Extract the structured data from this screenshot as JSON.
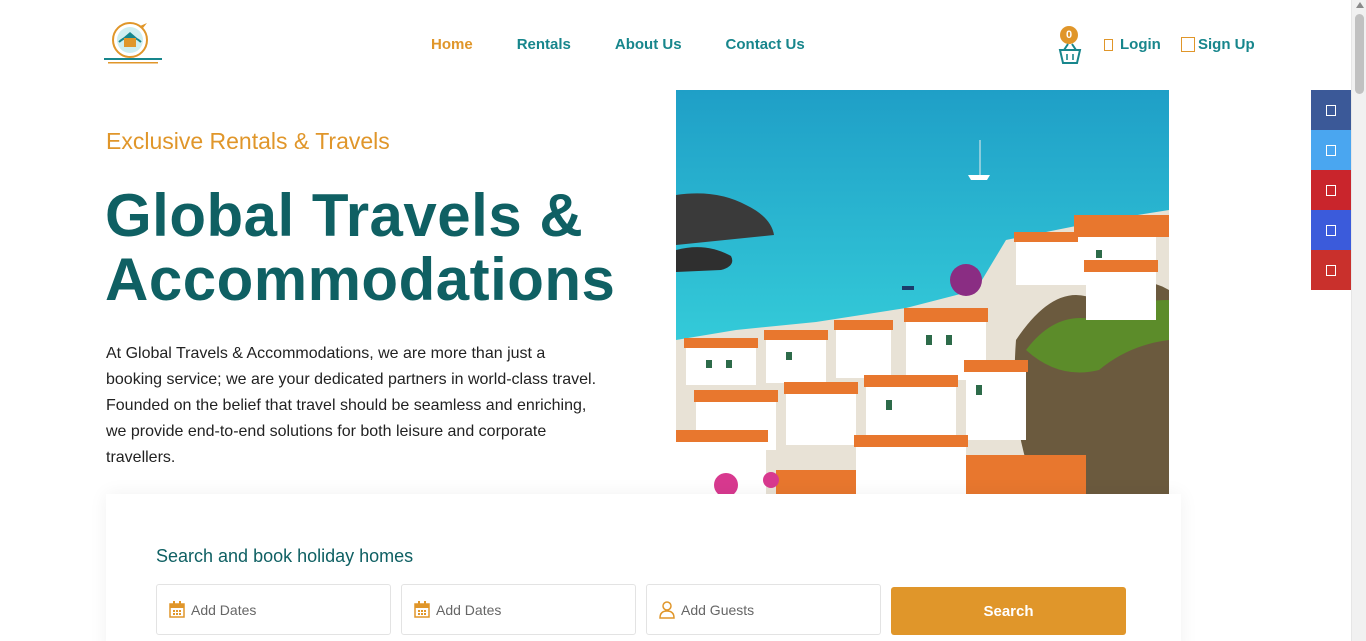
{
  "brand": {
    "logo_text": "Global Travels & Accommodations",
    "logo_tagline": "Exclusive Rentals & Travels"
  },
  "nav": {
    "items": [
      {
        "label": "Home",
        "active": true
      },
      {
        "label": "Rentals",
        "active": false
      },
      {
        "label": "About Us",
        "active": false
      },
      {
        "label": "Contact Us",
        "active": false
      }
    ]
  },
  "header": {
    "cart_count": "0",
    "login_label": "Login",
    "signup_label": "Sign Up"
  },
  "hero": {
    "eyebrow": "Exclusive Rentals & Travels",
    "title_line1": "Global Travels &",
    "title_line2": "Accommodations",
    "description": "At Global Travels & Accommodations, we are more than just a booking service; we are your dedicated partners in world-class travel. Founded on the belief that travel should be seamless and enriching, we provide end-to-end solutions for both leisure and corporate travellers."
  },
  "social": {
    "items": [
      {
        "name": "facebook",
        "color": "#3b5998"
      },
      {
        "name": "twitter",
        "color": "#4aa6f0"
      },
      {
        "name": "pinterest",
        "color": "#c9252c"
      },
      {
        "name": "linkedin",
        "color": "#3b5bdb"
      },
      {
        "name": "email",
        "color": "#c9302c"
      }
    ]
  },
  "search": {
    "title": "Search and book holiday homes",
    "checkin_placeholder": "Add Dates",
    "checkout_placeholder": "Add Dates",
    "guests_placeholder": "Add Guests",
    "button_label": "Search"
  },
  "colors": {
    "accent": "#e0962a",
    "teal": "#17868c",
    "dark_teal": "#0f6063"
  }
}
